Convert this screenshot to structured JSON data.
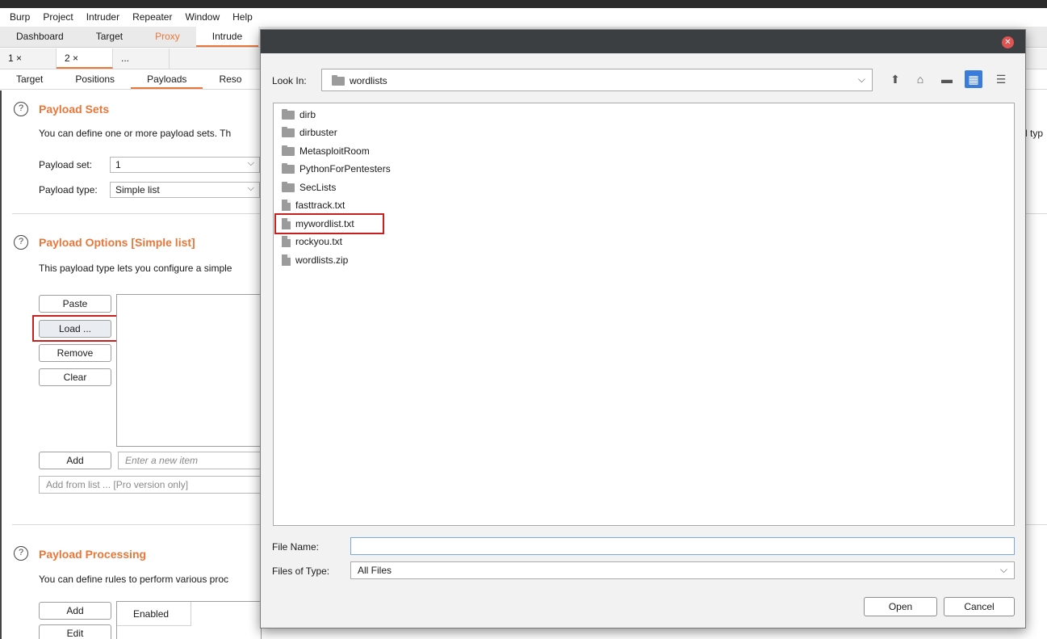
{
  "menubar": {
    "items": [
      "Burp",
      "Project",
      "Intruder",
      "Repeater",
      "Window",
      "Help"
    ]
  },
  "top_tabs": [
    "Dashboard",
    "Target",
    "Proxy",
    "Intrude"
  ],
  "sub_tabs": [
    "1 ×",
    "2 ×",
    "..."
  ],
  "payload_tabs": [
    "Target",
    "Positions",
    "Payloads",
    "Reso"
  ],
  "payload_sets": {
    "title": "Payload Sets",
    "desc": "You can define one or more payload sets. Th",
    "desc_tail": "l typ",
    "set_label": "Payload set:",
    "set_value": "1",
    "type_label": "Payload type:",
    "type_value": "Simple list"
  },
  "payload_options": {
    "title": "Payload Options [Simple list]",
    "desc": "This payload type lets you configure a simple",
    "paste": "Paste",
    "load": "Load ...",
    "remove": "Remove",
    "clear": "Clear",
    "add": "Add",
    "new_item_placeholder": "Enter a new item",
    "add_from_list": "Add from list ... [Pro version only]"
  },
  "payload_processing": {
    "title": "Payload Processing",
    "desc": "You can define rules to perform various proc",
    "add": "Add",
    "edit": "Edit",
    "col_enabled": "Enabled"
  },
  "dialog": {
    "look_in_label": "Look In:",
    "look_in_value": "wordlists",
    "entries": [
      {
        "name": "dirb",
        "kind": "folder"
      },
      {
        "name": "dirbuster",
        "kind": "folder"
      },
      {
        "name": "MetasploitRoom",
        "kind": "folder"
      },
      {
        "name": "PythonForPentesters",
        "kind": "folder"
      },
      {
        "name": "SecLists",
        "kind": "folder"
      },
      {
        "name": "fasttrack.txt",
        "kind": "file"
      },
      {
        "name": "mywordlist.txt",
        "kind": "file"
      },
      {
        "name": "rockyou.txt",
        "kind": "file"
      },
      {
        "name": "wordlists.zip",
        "kind": "file"
      }
    ],
    "file_name_label": "File Name:",
    "file_name_value": "",
    "files_of_type_label": "Files of Type:",
    "files_of_type_value": "All Files",
    "open": "Open",
    "cancel": "Cancel"
  },
  "colors": {
    "accent": "#e9773a",
    "highlight_box": "#c91f1f",
    "selected_view": "#3b7bd9"
  }
}
